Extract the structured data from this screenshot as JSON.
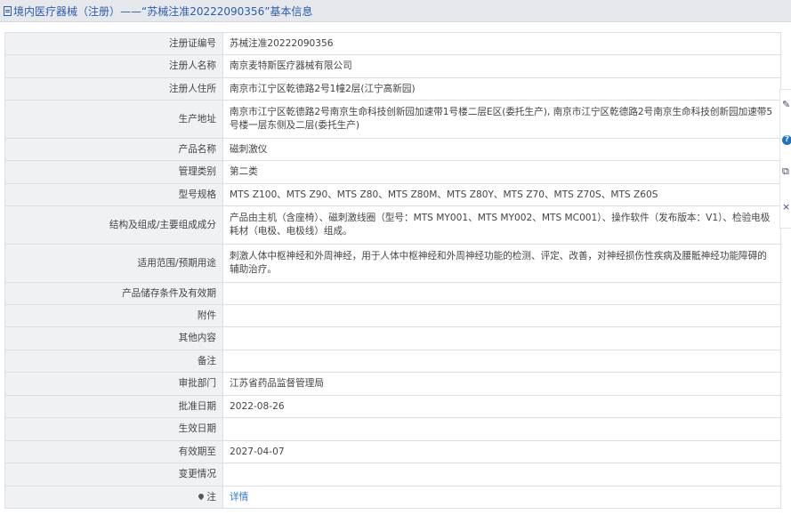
{
  "header": {
    "title": "境内医疗器械（注册）——“苏械注准20222090356”基本信息"
  },
  "rows": [
    {
      "label": "注册证编号",
      "value": "苏械注准20222090356"
    },
    {
      "label": "注册人名称",
      "value": "南京麦特斯医疗器械有限公司"
    },
    {
      "label": "注册人住所",
      "value": "南京市江宁区乾德路2号1幢2层(江宁高新园)"
    },
    {
      "label": "生产地址",
      "value": "南京市江宁区乾德路2号南京生命科技创新园加速带1号楼二层E区(委托生产), 南京市江宁区乾德路2号南京生命科技创新园加速带5号楼一层东侧及二层(委托生产)"
    },
    {
      "label": "产品名称",
      "value": "磁刺激仪"
    },
    {
      "label": "管理类别",
      "value": "第二类"
    },
    {
      "label": "型号规格",
      "value": "MTS Z100、MTS Z90、MTS Z80、MTS Z80M、MTS Z80Y、MTS Z70、MTS Z70S、MTS Z60S"
    },
    {
      "label": "结构及组成/主要组成成分",
      "value": "产品由主机（含座椅）、磁刺激线圈（型号：MTS MY001、MTS MY002、MTS MC001）、操作软件（发布版本：V1）、检验电极耗材（电极、电极线）组成。"
    },
    {
      "label": "适用范围/预期用途",
      "value": "刺激人体中枢神经和外周神经，用于人体中枢神经和外周神经功能的检测、评定、改善，对神经损伤性疾病及腰骶神经功能障碍的辅助治疗。"
    },
    {
      "label": "产品储存条件及有效期",
      "value": ""
    },
    {
      "label": "附件",
      "value": ""
    },
    {
      "label": "其他内容",
      "value": ""
    },
    {
      "label": "备注",
      "value": ""
    },
    {
      "label": "审批部门",
      "value": "江苏省药品监督管理局"
    },
    {
      "label": "批准日期",
      "value": "2022-08-26"
    },
    {
      "label": "生效日期",
      "value": ""
    },
    {
      "label": "有效期至",
      "value": "2027-04-07"
    },
    {
      "label": "变更情况",
      "value": ""
    },
    {
      "label": "注",
      "value": "详情"
    }
  ],
  "sidebar": {
    "items": [
      "edit-icon",
      "help-icon",
      "copy-icon",
      "close-icon"
    ]
  }
}
